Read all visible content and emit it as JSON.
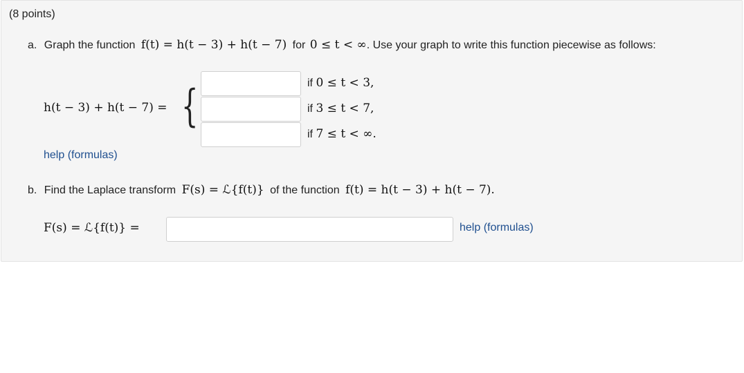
{
  "question": {
    "points": "(8 points)",
    "part_a": {
      "prefix": "a.",
      "text_before": "Graph the function",
      "function_expr": "f(t) = h(t − 3) + h(t − 7)",
      "for_text": "for",
      "domain_expr": "0 ≤ t < ∞",
      "text_after": ". Use your graph to write this function piecewise as follows:",
      "lhs_expr": "h(t − 3) + h(t − 7) =",
      "cases": [
        {
          "if_text": "if",
          "condition": "0 ≤ t < 3,",
          "value": ""
        },
        {
          "if_text": "if",
          "condition": "3 ≤ t < 7,",
          "value": ""
        },
        {
          "if_text": "if",
          "condition": "7 ≤ t < ∞.",
          "value": ""
        }
      ],
      "help_link": "help (formulas)"
    },
    "part_b": {
      "prefix": "b.",
      "text_before": "Find the Laplace transform",
      "transform_expr": "F(s) = ℒ{f(t)}",
      "text_middle": "of the function",
      "function_expr": "f(t) = h(t − 3) + h(t − 7).",
      "lhs_expr": "F(s) = ℒ{f(t)} =",
      "answer_value": "",
      "help_link": "help (formulas)"
    }
  }
}
